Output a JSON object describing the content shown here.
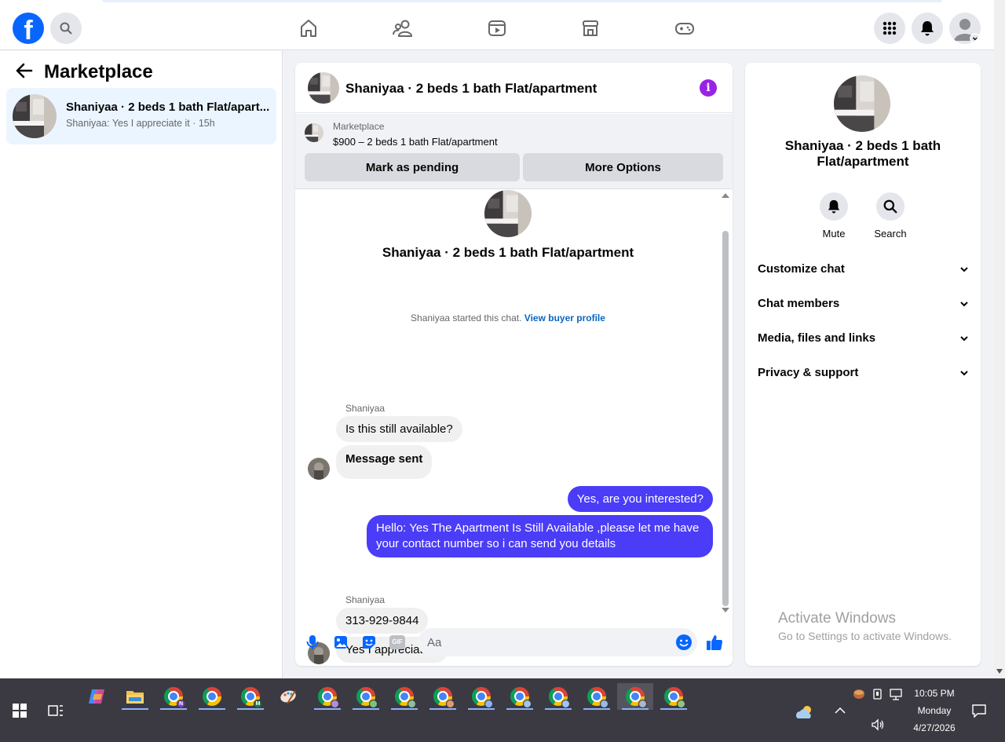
{
  "topbar": {
    "logo": "f",
    "nav": [
      "home-icon",
      "friends-icon",
      "watch-icon",
      "marketplace-icon",
      "gaming-icon"
    ],
    "right": [
      "menu-grid-icon",
      "notifications-icon",
      "account-avatar"
    ]
  },
  "left_panel": {
    "title": "Marketplace",
    "conversation": {
      "name": "Shaniyaa · 2 beds 1 bath Flat/apart...",
      "snippet": "Shaniyaa: Yes I appreciate it · 15h"
    }
  },
  "chat": {
    "title": "Shaniyaa · 2 beds 1 bath Flat/apartment",
    "listing": {
      "label": "Marketplace",
      "price_line": "$900 – 2 beds 1 bath Flat/apartment",
      "pending_button": "Mark as pending",
      "options_button": "More Options"
    },
    "intro_title": "Shaniyaa · 2 beds 1 bath Flat/apartment",
    "system_text": "Shaniyaa started this chat.",
    "system_link": "View buyer profile",
    "messages": {
      "sender1": "Shaniyaa",
      "in1": "Is this still available?",
      "in2": "Message sent",
      "out1": "Yes, are you interested?",
      "out2": "Hello: Yes The Apartment Is Still Available ,please let me have your contact number so i can send you details",
      "sender2": "Shaniyaa",
      "in3": "313-929-9844",
      "in4": "Yes I appreciate it"
    },
    "composer": {
      "placeholder": "Aa",
      "gif_label": "GIF"
    }
  },
  "right_panel": {
    "title": "Shaniyaa · 2 beds 1 bath Flat/apartment",
    "mute": "Mute",
    "search": "Search",
    "sections": [
      "Customize chat",
      "Chat members",
      "Media, files and links",
      "Privacy & support"
    ],
    "watermark_title": "Activate Windows",
    "watermark_sub": "Go to Settings to activate Windows."
  },
  "taskbar": {
    "time": "10:05 PM",
    "day": "Monday",
    "date": "4/27/2026"
  },
  "colors": {
    "fb_blue": "#0866ff",
    "outgoing_bubble": "#4a3cf7",
    "info_purple": "#9a22e6",
    "link_blue": "#0a66c2"
  }
}
